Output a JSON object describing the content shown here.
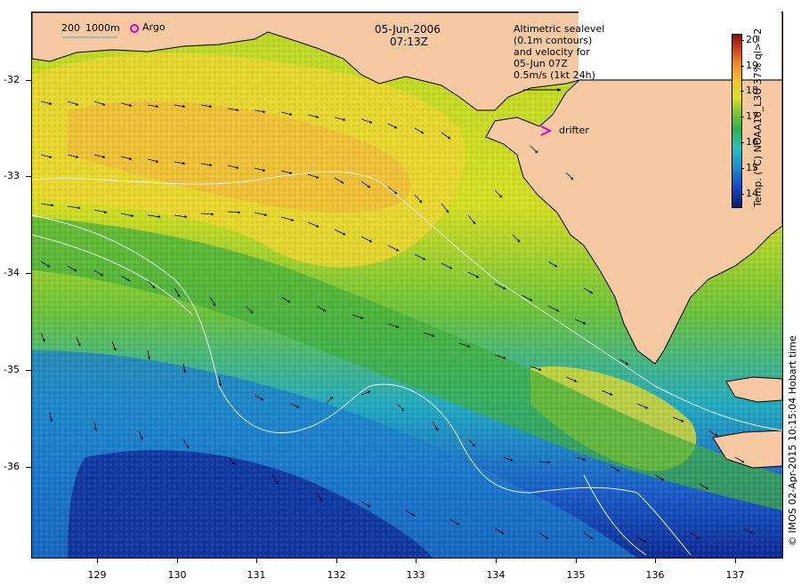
{
  "map": {
    "date": "05-Jun-2006",
    "time": "07:13Z",
    "scale_label_200": "200",
    "scale_label_1000": "1000m",
    "argo_label": "Argo",
    "drifter_label": "drifter",
    "legend_lines": [
      "Altimetric sealevel",
      "(0.1m contours)",
      "and velocity for",
      "05-Jun 07Z",
      "0.5m/s (1kt 24h)"
    ],
    "colorbar": {
      "caption": "Temp. (°C) NOAA16_L3U 37% ql>=2",
      "ticks": [
        "20",
        "19",
        "18",
        "17",
        "16",
        "15",
        "14"
      ],
      "min": 13.6,
      "max": 20.3
    },
    "credit": "© IMOS 02-Apr-2015 10:15:04 Hobart time",
    "y_axis_labels": [
      "-32",
      "-33",
      "-34",
      "-35",
      "-36"
    ],
    "x_axis_labels": [
      "129",
      "130",
      "131",
      "132",
      "133",
      "134",
      "135",
      "136",
      "137"
    ],
    "colors": {
      "land": "#f6c9a2",
      "argo_marker": "#e000c8",
      "drifter_marker": "#e000c8",
      "scale_line": "#33c0b8",
      "contour": "#e0f0f0"
    }
  }
}
